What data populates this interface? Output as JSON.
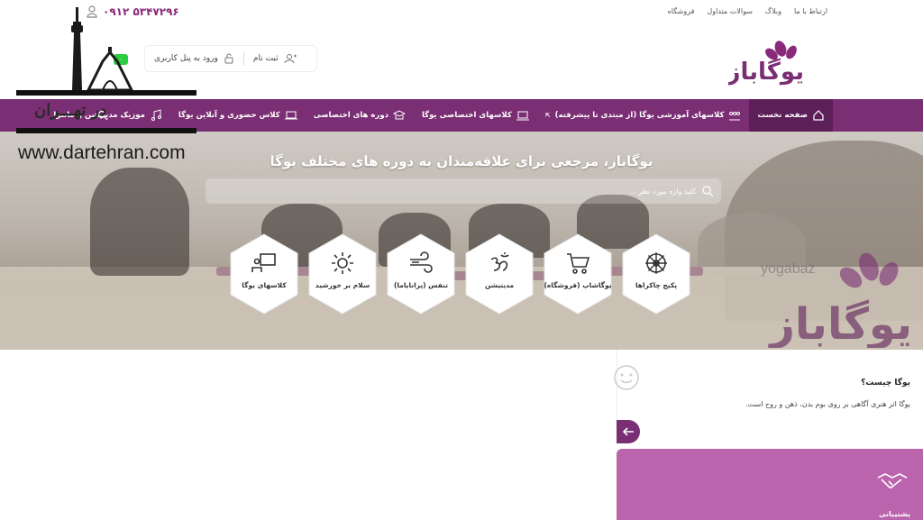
{
  "top_links": [
    "ارتباط با ما",
    "وبلاگ",
    "سوالات متداول",
    "فروشگاه"
  ],
  "phone": "۰۹۱۲ ۵۳۴۷۲۹۶",
  "auth": {
    "login": "ورود به پنل کاربری",
    "register": "ثبت نام"
  },
  "badge": "۰",
  "logo_text": "یوگاباز",
  "nav": {
    "items": [
      {
        "label": "صفحه نخست",
        "icon": "home-icon"
      },
      {
        "label": "کلاسهای آموزشی یوگا (از مبتدی تا پیشرفته)",
        "icon": "group-icon"
      },
      {
        "label": "کلاسهای اختصاصی یوگا",
        "icon": "laptop-user-icon"
      },
      {
        "label": "دوره های اختصاصی",
        "icon": "graduation-icon"
      },
      {
        "label": "کلاس حضوری و آنلاین یوگا",
        "icon": "laptop-icon"
      },
      {
        "label": "موزیک مدیتیشن و مانترا",
        "icon": "music-icon"
      }
    ]
  },
  "overlay": {
    "brand_fa": "در تهـــران",
    "website": "www.dartehran.com"
  },
  "hero": {
    "title": "یوگاباز، مرجعی برای علاقه‌مندان به دوره های مختلف یوگا",
    "search_placeholder": "کلید واژه مورد نظر ...",
    "hexes": [
      {
        "label": "پکیج چاکراها",
        "icon": "dharma-wheel-icon"
      },
      {
        "label": "یوگاشاپ (فروشگاه)",
        "icon": "cart-icon"
      },
      {
        "label": "مدیتیشن",
        "icon": "om-icon"
      },
      {
        "label": "تنفس (پرانایاما)",
        "icon": "wind-icon"
      },
      {
        "label": "سلام بر خورشید",
        "icon": "sun-icon"
      },
      {
        "label": "کلاسهای یوگا",
        "icon": "presentation-icon"
      }
    ],
    "watermark_en": "yogabaz"
  },
  "what": {
    "title": "یوگا چیست؟",
    "text": "یوگا اثر هنری آگاهی بر روی بوم بدن، ذهن و روح است."
  },
  "support": {
    "label": "پشتیبانی"
  },
  "colors": {
    "brand": "#7a2e73",
    "nav_active": "#5d1f58",
    "support": "#b964ad"
  }
}
